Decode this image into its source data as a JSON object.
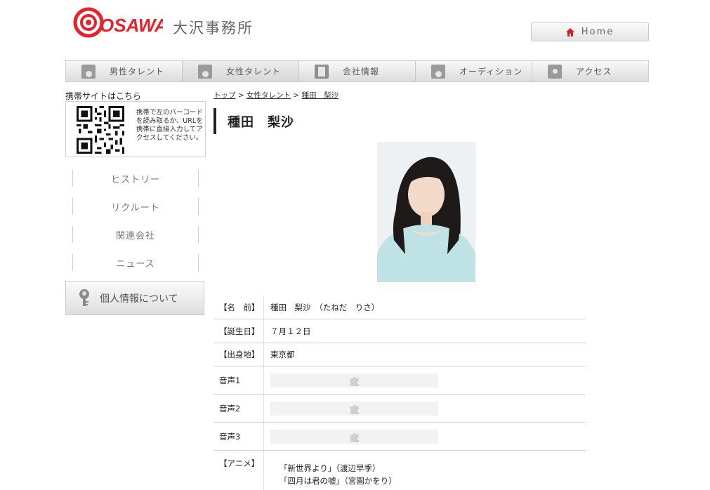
{
  "header": {
    "logo_text": "OSAWA",
    "company_name": "大沢事務所",
    "home_label": "Home"
  },
  "nav": {
    "items": [
      {
        "label": "男性タレント"
      },
      {
        "label": "女性タレント"
      },
      {
        "label": "会社情報"
      },
      {
        "label": "オーディション"
      },
      {
        "label": "アクセス"
      }
    ]
  },
  "sidebar": {
    "mobile_title": "携帯サイトはこちら",
    "qr_text": "携帯で左のバーコードを読み取るか、URLを携帯に直接入力してアクセスしてください。",
    "links": [
      {
        "label": "ヒストリー"
      },
      {
        "label": "リクルート"
      },
      {
        "label": "関連会社"
      },
      {
        "label": "ニュース"
      }
    ],
    "privacy_label": "個人情報について"
  },
  "breadcrumb": {
    "top": "トップ",
    "sep": ">",
    "category": "女性タレント",
    "current": "種田　梨沙"
  },
  "profile": {
    "name_title": "種田　梨沙",
    "rows": [
      {
        "label": "【名　前】",
        "value": "種田　梨沙　（たねだ　りさ）"
      },
      {
        "label": "【誕生日】",
        "value": "７月１２日"
      },
      {
        "label": "【出身地】",
        "value": "東京都"
      }
    ],
    "audio": [
      {
        "label": "音声1"
      },
      {
        "label": "音声2"
      },
      {
        "label": "音声3"
      }
    ],
    "anime_label": "【アニメ】",
    "anime": [
      "「新世界より」（渡辺早季）",
      "「四月は君の嘘」（宮園かをり）"
    ]
  },
  "colors": {
    "brand_red": "#e8202a",
    "nav_bg": "#e6e6e6"
  }
}
